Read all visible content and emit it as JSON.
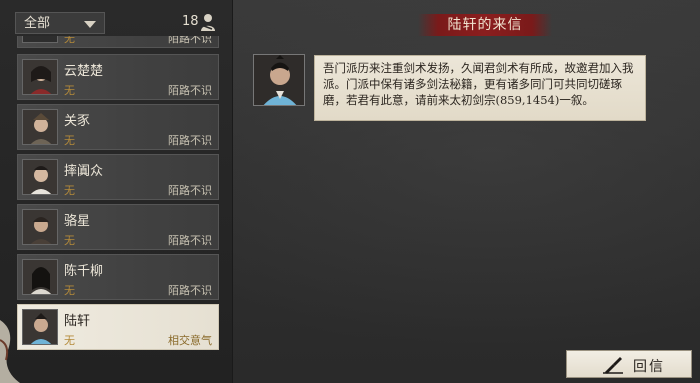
{
  "filter": {
    "selected": "全部"
  },
  "count": "18",
  "list": {
    "items": [
      {
        "name": "",
        "sect": "无",
        "relation": "陌路不识"
      },
      {
        "name": "云楚楚",
        "sect": "无",
        "relation": "陌路不识"
      },
      {
        "name": "关豕",
        "sect": "无",
        "relation": "陌路不识"
      },
      {
        "name": "摔阗众",
        "sect": "无",
        "relation": "陌路不识"
      },
      {
        "name": "骆星",
        "sect": "无",
        "relation": "陌路不识"
      },
      {
        "name": "陈千柳",
        "sect": "无",
        "relation": "陌路不识"
      },
      {
        "name": "陆轩",
        "sect": "无",
        "relation": "相交意气"
      }
    ]
  },
  "letter": {
    "title": "陆轩的来信",
    "body": "吾门派历来注重剑术发扬，久闻君剑术有所成，故邀君加入我派。门派中保有诸多剑法秘籍，更有诸多同门可共同切磋琢磨，若君有此意，请前来太初剑宗(859,1454)一叙。"
  },
  "reply_button": {
    "label": "回信"
  },
  "colors": {
    "banner": "#8b1e1e",
    "sect_text": "#b48a3a",
    "paper": "#ece6d8"
  },
  "icons": {
    "count": "person-icon",
    "reply": "brush-icon",
    "filter": "chevron-down-icon"
  }
}
